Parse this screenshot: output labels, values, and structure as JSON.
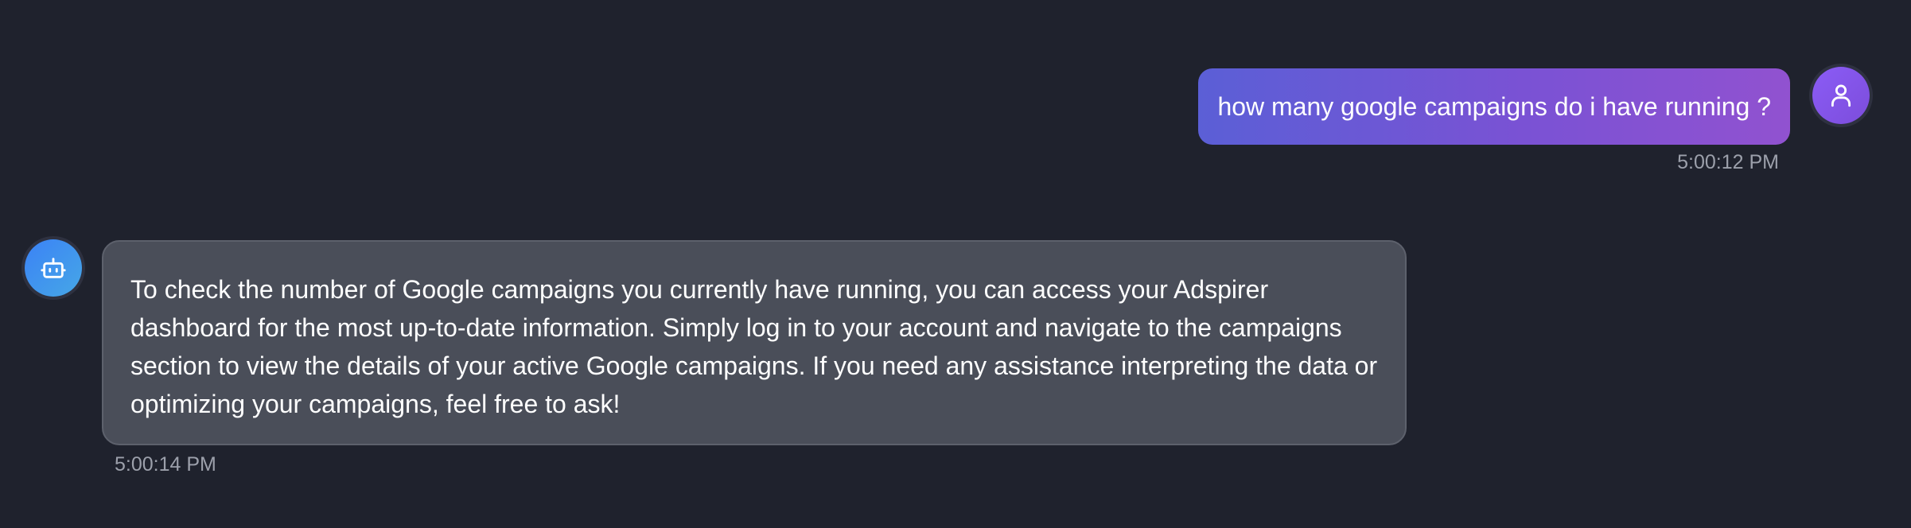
{
  "messages": [
    {
      "role": "user",
      "text": "how many google campaigns do i have running ?",
      "time": "5:00:12 PM",
      "avatar_icon": "user-icon"
    },
    {
      "role": "assistant",
      "text": "To check the number of Google campaigns you currently have running, you can access your Adspirer dashboard for the most up-to-date information. Simply log in to your account and navigate to the campaigns section to view the details of your active Google campaigns. If you need any assistance interpreting the data or optimizing your campaigns, feel free to ask!",
      "time": "5:00:14 PM",
      "avatar_icon": "bot-icon"
    }
  ],
  "colors": {
    "background": "#1f222d",
    "user_bubble_start": "#5b5fd6",
    "user_bubble_end": "#9152d0",
    "bot_bubble": "#4a4e59",
    "timestamp": "#9ca0ab"
  }
}
